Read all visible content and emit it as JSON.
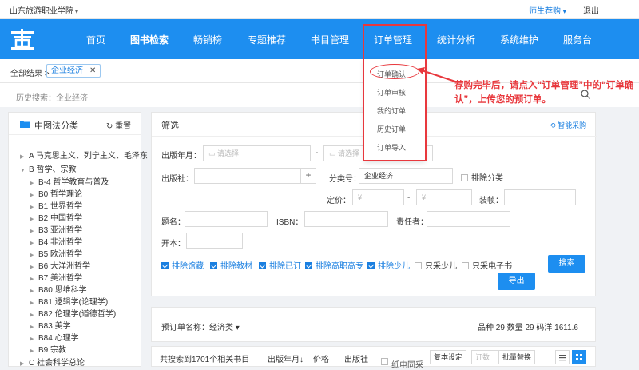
{
  "topbar": {
    "school": "山东旅游职业学院",
    "school_caret": "▾",
    "user": "师生荐购",
    "user_caret": "▾",
    "logout": "退出"
  },
  "navbar": {
    "logo": "logo",
    "items": [
      "首页",
      "图书检索",
      "畅销榜",
      "专题推荐",
      "书目管理",
      "订单管理",
      "统计分析",
      "系统维护",
      "服务台"
    ]
  },
  "breadcrumb": {
    "all": "全部结果",
    "sep": ">",
    "tag": "企业经济",
    "tag_close": "✕"
  },
  "history": {
    "text": "历史搜索：企业经济",
    "icon": "search-icon"
  },
  "left_panel": {
    "title": "中图法分类",
    "reset": "重置",
    "items": [
      {
        "label": "A 马克思主义、列宁主义、毛泽东",
        "arrow": "▶"
      },
      {
        "label": "B 哲学、宗教",
        "arrow": "▼"
      },
      {
        "label": "B-4 哲学教育与普及",
        "arrow": "▶"
      },
      {
        "label": "B0 哲学理论",
        "arrow": "▶"
      },
      {
        "label": "B1 世界哲学",
        "arrow": "▶"
      },
      {
        "label": "B2 中国哲学",
        "arrow": "▶"
      },
      {
        "label": "B3 亚洲哲学",
        "arrow": "▶"
      },
      {
        "label": "B4 非洲哲学",
        "arrow": "▶"
      },
      {
        "label": "B5 欧洲哲学",
        "arrow": "▶"
      },
      {
        "label": "B6 大洋洲哲学",
        "arrow": "▶"
      },
      {
        "label": "B7 美洲哲学",
        "arrow": "▶"
      },
      {
        "label": "B80 思维科学",
        "arrow": "▶"
      },
      {
        "label": "B81 逻辑学(论理学)",
        "arrow": "▶"
      },
      {
        "label": "B82 伦理学(道德哲学)",
        "arrow": "▶"
      },
      {
        "label": "B83 美学",
        "arrow": "▶"
      },
      {
        "label": "B84 心理学",
        "arrow": "▶"
      },
      {
        "label": "B9 宗教",
        "arrow": "▶"
      },
      {
        "label": "C 社会科学总论",
        "arrow": "▶"
      }
    ]
  },
  "filter": {
    "title": "筛选",
    "smart": "智能采购",
    "pub_date_label": "出版年月：",
    "pub_date_placeholder": "请选择",
    "pub_date_sep": "-",
    "publisher_label": "出版社：",
    "category_label": "分类号：",
    "category_value": "企业经济",
    "exclude_category": "排除分类",
    "price_label": "定价：",
    "price_placeholder": "¥",
    "price_sep": "-",
    "binding_label": "装帧：",
    "title_label": "题名：",
    "isbn_label": "ISBN：",
    "author_label": "责任者：",
    "format_label": "开本：",
    "checks": [
      {
        "label": "排除馆藏",
        "checked": true
      },
      {
        "label": "排除教材",
        "checked": true
      },
      {
        "label": "排除已订",
        "checked": true
      },
      {
        "label": "排除高职高专",
        "checked": true
      },
      {
        "label": "排除少儿",
        "checked": true
      },
      {
        "label": "只采少儿",
        "checked": false
      },
      {
        "label": "只采电子书",
        "checked": false
      }
    ],
    "search_btn": "搜索",
    "export_btn": "导出"
  },
  "order_bar": {
    "name": "预订单名称：经济类",
    "name_caret": "▾",
    "stats": "品种 29    数量 29    码洋 1611.6"
  },
  "results_bar": {
    "count": "共搜索到1701个相关书目",
    "sort_date": "出版年月↓",
    "sort_price": "价格",
    "sort_publisher": "出版社",
    "paper_same": "纸电同采",
    "copies_setting": "复本设定",
    "copies_placeholder": "订数",
    "batch_replace": "批量替换"
  },
  "order_menu": {
    "items": [
      "订单确认",
      "订单审核",
      "我的订单",
      "历史订单",
      "订单导入"
    ]
  },
  "annotation": "荐购完毕后，请点入“订单管理”中的“订单确认”，上传您的预订单。",
  "colors": {
    "brand": "#1d8ef0",
    "annotation": "#e8383d"
  }
}
